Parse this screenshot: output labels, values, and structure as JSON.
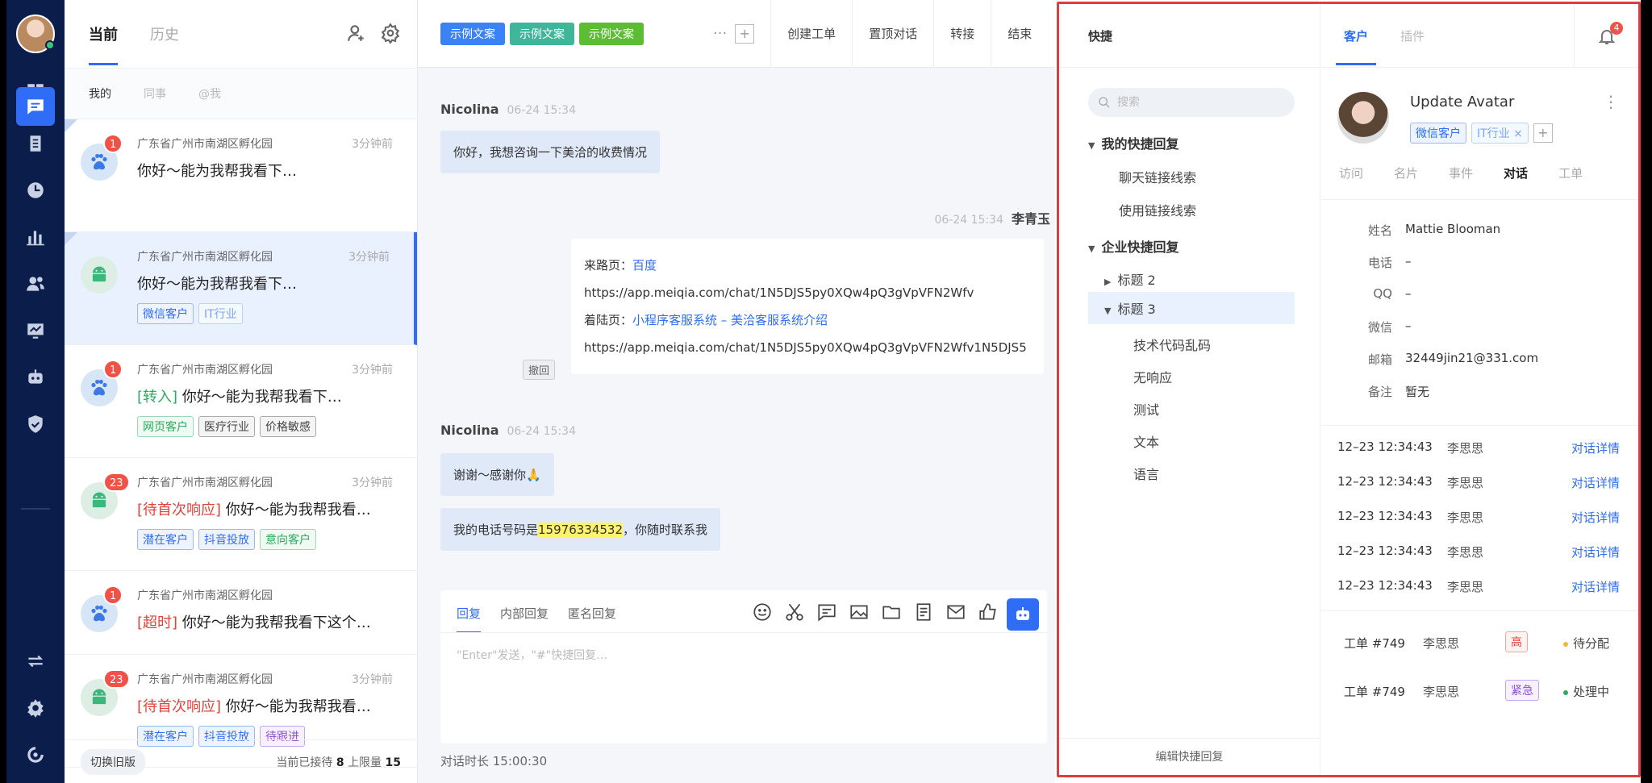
{
  "colors": {
    "nav_bg": "#0b1d4b",
    "accent": "#2f6df6",
    "highlight_border": "#e23b3b"
  },
  "nav": {
    "items": [
      "dashboard-icon",
      "chat-icon",
      "clipboard-icon",
      "clock-icon",
      "bar-chart-icon",
      "contacts-icon",
      "monitor-icon",
      "robot-icon",
      "shield-icon",
      "transfer-icon",
      "settings-icon",
      "logout-icon"
    ],
    "active": "chat-icon"
  },
  "list": {
    "tabs": [
      "当前",
      "历史"
    ],
    "subtabs": [
      "我的",
      "同事",
      "@我"
    ],
    "conversations": [
      {
        "badge": "1",
        "avatar": "paw-icon",
        "loc": "广东省广州市南湖区孵化园",
        "time": "3分钟前",
        "prefix": "",
        "prefix_color": "",
        "msg": "你好～能为我帮我看下…",
        "tags": []
      },
      {
        "badge": "",
        "avatar": "android-icon",
        "loc": "广东省广州市南湖区孵化园",
        "time": "3分钟前",
        "prefix": "",
        "prefix_color": "",
        "msg": "你好～能为我帮我看下…",
        "tags": [
          {
            "t": "微信客户",
            "c": "blue"
          },
          {
            "t": "IT行业",
            "c": "lblue"
          }
        ]
      },
      {
        "badge": "1",
        "avatar": "paw-icon",
        "loc": "广东省广州市南湖区孵化园",
        "time": "3分钟前",
        "prefix": "[转入]",
        "prefix_color": "green",
        "msg": "你好～能为我帮我看下…",
        "tags": [
          {
            "t": "网页客户",
            "c": "green"
          },
          {
            "t": "医疗行业",
            "c": "gray"
          },
          {
            "t": "价格敏感",
            "c": "gray"
          }
        ]
      },
      {
        "badge": "23",
        "avatar": "android-icon",
        "loc": "广东省广州市南湖区孵化园",
        "time": "3分钟前",
        "prefix": "[待首次响应]",
        "prefix_color": "red",
        "msg": "你好～能为我帮我看…",
        "tags": [
          {
            "t": "潜在客户",
            "c": "blue"
          },
          {
            "t": "抖音投放",
            "c": "blue"
          },
          {
            "t": "意向客户",
            "c": "green"
          }
        ]
      },
      {
        "badge": "1",
        "avatar": "paw-icon",
        "loc": "广东省广州市南湖区孵化园",
        "time": "",
        "prefix": "[超时]",
        "prefix_color": "red",
        "msg": "你好～能为我帮我看下这个…",
        "tags": []
      },
      {
        "badge": "23",
        "avatar": "android-icon",
        "loc": "广东省广州市南湖区孵化园",
        "time": "3分钟前",
        "prefix": "[待首次响应]",
        "prefix_color": "red",
        "msg": "你好～能为我帮我看…",
        "tags": [
          {
            "t": "潜在客户",
            "c": "blue"
          },
          {
            "t": "抖音投放",
            "c": "blue"
          },
          {
            "t": "待跟进",
            "c": "purple"
          }
        ]
      }
    ],
    "footer": {
      "switch_old": "切换旧版",
      "count_prefix": "当前已接待",
      "current": "8",
      "limit_prefix": "上限量",
      "limit": "15"
    }
  },
  "chat": {
    "pills": [
      "示例文案",
      "示例文案",
      "示例文案"
    ],
    "actions": [
      "创建工单",
      "置顶对话",
      "转接",
      "结束"
    ],
    "msg1": {
      "sender": "Nicolina",
      "time": "06-24 15:34",
      "text": "你好，我想咨询一下美洽的收费情况"
    },
    "agent": {
      "sender": "李青玉",
      "time": "06-24 15:34",
      "source_label": "来路页：",
      "source_link": "百度",
      "source_url": "https://app.meiqia.com/chat/1N5DJS5py0XQw4pQ3gVpVFN2Wfv",
      "landing_label": "着陆页：",
      "landing_link": "小程序客服系统 – 美洽客服系统介绍",
      "landing_url": "https://app.meiqia.com/chat/1N5DJS5py0XQw4pQ3gVpVFN2Wfv1N5DJS5",
      "recall": "撤回"
    },
    "msg2": {
      "sender": "Nicolina",
      "time": "06-24 15:34",
      "text": "谢谢～感谢你🙏"
    },
    "msg3": {
      "pre": "我的电话号码是",
      "phone": "15976334532",
      "post": "，你随时联系我"
    },
    "composer": {
      "tabs": [
        "回复",
        "内部回复",
        "匿名回复"
      ],
      "placeholder": "\"Enter\"发送，\"#\"快捷回复…"
    },
    "duration": "对话时长 15:00:30"
  },
  "quick": {
    "title": "快捷",
    "search_placeholder": "搜索",
    "my_group": "我的快捷回复",
    "my_items": [
      "聊天链接线索",
      "使用链接线索"
    ],
    "ent_group": "企业快捷回复",
    "title2": "标题 2",
    "title3": "标题 3",
    "title3_items": [
      "技术代码乱码",
      "无响应",
      "测试",
      "文本",
      "语言"
    ],
    "footer": "编辑快捷回复"
  },
  "customer": {
    "tabs": [
      "客户",
      "插件"
    ],
    "notif": "4",
    "name": "Update Avatar",
    "tags": [
      "微信客户",
      "IT行业 ×"
    ],
    "subtabs": [
      "访问",
      "名片",
      "事件",
      "对话",
      "工单"
    ],
    "info": [
      {
        "k": "姓名",
        "v": "Mattie Blooman"
      },
      {
        "k": "电话",
        "v": "–"
      },
      {
        "k": "QQ",
        "v": "–"
      },
      {
        "k": "微信",
        "v": "–"
      },
      {
        "k": "邮箱",
        "v": "32449jin21@331.com"
      },
      {
        "k": "备注",
        "v": "暂无"
      }
    ],
    "logs": [
      {
        "time": "12–23 12:34:43",
        "who": "李思思",
        "link": "对话详情"
      },
      {
        "time": "12–23 12:34:43",
        "who": "李思思",
        "link": "对话详情"
      },
      {
        "time": "12–23 12:34:43",
        "who": "李思思",
        "link": "对话详情"
      },
      {
        "time": "12–23 12:34:43",
        "who": "李思思",
        "link": "对话详情"
      },
      {
        "time": "12–23 12:34:43",
        "who": "李思思",
        "link": "对话详情"
      }
    ],
    "tickets": [
      {
        "id": "工单 #749",
        "who": "李思思",
        "pri": "高",
        "pri_c": "high",
        "status": "待分配",
        "dot": "#f5b82e"
      },
      {
        "id": "工单 #749",
        "who": "李思思",
        "pri": "紧急",
        "pri_c": "urg",
        "status": "处理中",
        "dot": "#2cab5f"
      }
    ]
  }
}
